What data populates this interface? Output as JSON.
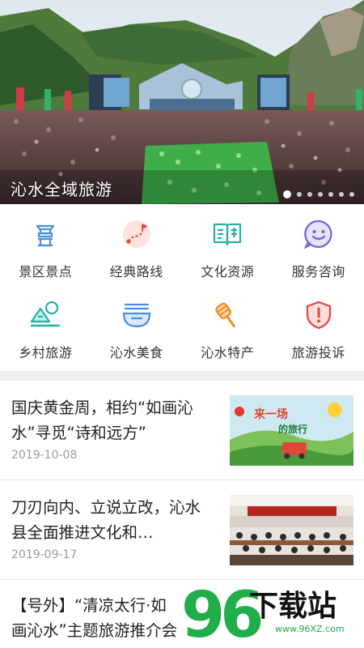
{
  "banner": {
    "caption": "沁水全域旅游",
    "dot_count": 7,
    "active_dot": 0
  },
  "categories": [
    {
      "label": "景区景点",
      "icon": "scenic-spot-icon"
    },
    {
      "label": "经典路线",
      "icon": "route-map-icon"
    },
    {
      "label": "文化资源",
      "icon": "open-book-icon"
    },
    {
      "label": "服务咨询",
      "icon": "smiley-chat-icon"
    },
    {
      "label": "乡村旅游",
      "icon": "village-hills-icon"
    },
    {
      "label": "沁水美食",
      "icon": "food-bowl-icon"
    },
    {
      "label": "沁水特产",
      "icon": "honey-dipper-icon"
    },
    {
      "label": "旅游投诉",
      "icon": "shield-alert-icon"
    }
  ],
  "news": [
    {
      "title": "国庆黄金周，相约“如画沁水”寻觅“诗和远方”",
      "date": "2019-10-08"
    },
    {
      "title": "刀刃向内、立说立改，沁水县全面推进文化和…",
      "date": "2019-09-17"
    },
    {
      "title": "【号外】“清凉太行·如画沁水”主题旅游推介会",
      "date": ""
    }
  ],
  "colors": {
    "icon_blue": "#4a8fd8",
    "icon_teal": "#27b0a4",
    "icon_orange": "#f08a24",
    "icon_red": "#e8453c",
    "watermark_green": "#1fae4a"
  },
  "watermark": {
    "brand": "下载站",
    "number": "96",
    "url": "www.96XZ.com"
  }
}
